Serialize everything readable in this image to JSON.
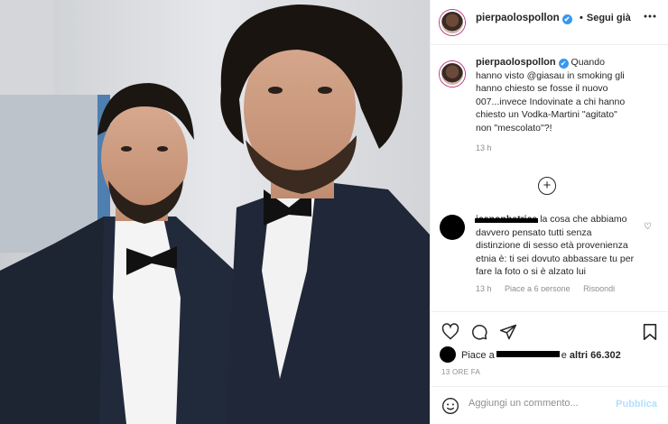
{
  "post": {
    "username": "pierpaolospollon",
    "verified_glyph": "✔",
    "follow_dot": "•",
    "follow_label": "Segui già",
    "more_icon": "more-icon",
    "caption": "Quando hanno visto @giasau in smoking gli hanno chiesto se fosse il nuovo 007...invece Indovinate a chi hanno chiesto un Vodka-Martini \"agitato\" non \"mescolato\"?!",
    "caption_time": "13 h",
    "load_more_glyph": "+"
  },
  "comment": {
    "username": "icanonbetrice",
    "text": "la cosa che abbiamo davvero pensato tutti senza distinzione di sesso età provenienza etnia è: ti sei dovuto abbassare tu per fare la foto o si è alzato lui",
    "time": "13 h",
    "likes": "Piace a 6 persone",
    "reply": "Rispondi",
    "heart_glyph": "♡"
  },
  "likes": {
    "prefix": "Piace a",
    "suffix": "e",
    "others": "altri 66.302"
  },
  "date": "13 ORE FA",
  "add_comment": {
    "placeholder": "Aggiungi un commento...",
    "post_label": "Pubblica"
  },
  "colors": {
    "accent_blue": "#3897f0",
    "disabled_blue": "#b2dffc",
    "muted_text": "#8e8e8e"
  }
}
